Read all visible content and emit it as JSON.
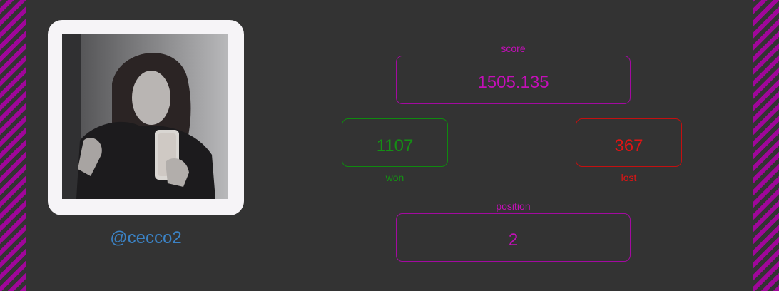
{
  "profile": {
    "username": "@cecco2",
    "avatar_alt": "profile photo"
  },
  "stats": {
    "score_label": "score",
    "score_value": "1505.135",
    "won_label": "won",
    "won_value": "1107",
    "lost_label": "lost",
    "lost_value": "367",
    "position_label": "position",
    "position_value": "2"
  },
  "colors": {
    "background": "#333333",
    "stripe": "#a0069a",
    "accent_magenta": "#c40fb8",
    "won_green": "#149014",
    "lost_red": "#e01414",
    "username_blue": "#3b82c4"
  }
}
